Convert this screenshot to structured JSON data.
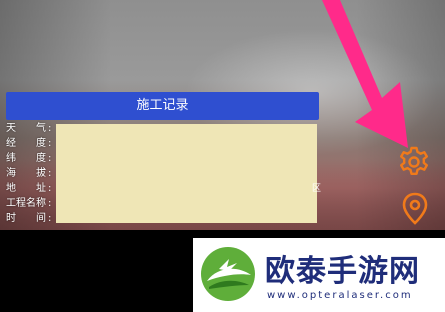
{
  "record": {
    "title": "施工记录",
    "fields": [
      {
        "label": "天　　气"
      },
      {
        "label": "经　　度"
      },
      {
        "label": "纬　　度"
      },
      {
        "label": "海　　拔"
      },
      {
        "label": "地　　址"
      },
      {
        "label": "工程名称"
      },
      {
        "label": "时　　间"
      }
    ],
    "edge_char": "区"
  },
  "icons": {
    "settings": "gear-icon",
    "location": "location-pin-icon",
    "annotation_arrow": "arrow-icon",
    "accent": "#f07a1a",
    "arrow_color": "#ff2a8a"
  },
  "watermark": {
    "title": "欧泰手游网",
    "url": "www.opteralaser.com"
  }
}
